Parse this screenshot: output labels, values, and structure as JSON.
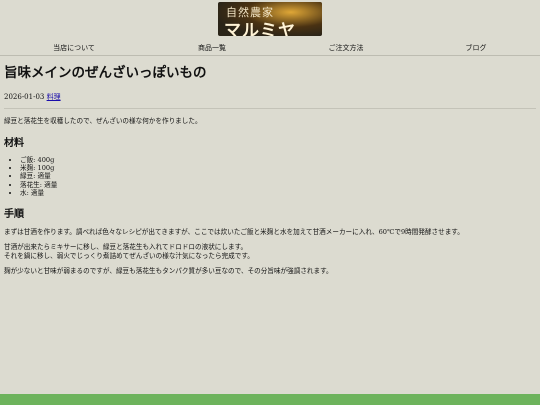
{
  "logo": {
    "line1": "自然農家",
    "line2": "マルミヤ"
  },
  "nav": {
    "items": [
      "当店について",
      "商品一覧",
      "ご注文方法",
      "ブログ"
    ]
  },
  "post": {
    "title": "旨味メインのぜんざいっぽいもの",
    "date": "2026-01-03",
    "category": "料理",
    "intro": "緑豆と落花生を収穫したので、ぜんざいの様な何かを作りました。",
    "ingredients_heading": "材料",
    "ingredients": [
      "ご飯: 400g",
      "米麹: 100g",
      "緑豆: 適量",
      "落花生: 適量",
      "水: 適量"
    ],
    "steps_heading": "手順",
    "steps": [
      "まずは甘酒を作ります。調べれば色々なレシピが出てきますが、ここでは炊いたご飯と米麹と水を加えて甘酒メーカーに入れ、60℃で9時間発酵させます。",
      "甘酒が出来たらミキサーに移し、緑豆と落花生も入れてドロドロの液状にします。",
      "それを鍋に移し、弱火でじっくり煮詰めてぜんざいの様な汁気になったら完成です。",
      "麹が少ないと甘味が弱まるのですが、緑豆も落花生もタンパク質が多い豆なので、その分旨味が強調されます。"
    ]
  },
  "colors": {
    "background": "#dcdbd0",
    "bottom_bar": "#6db35c",
    "link": "#1a0dab"
  }
}
